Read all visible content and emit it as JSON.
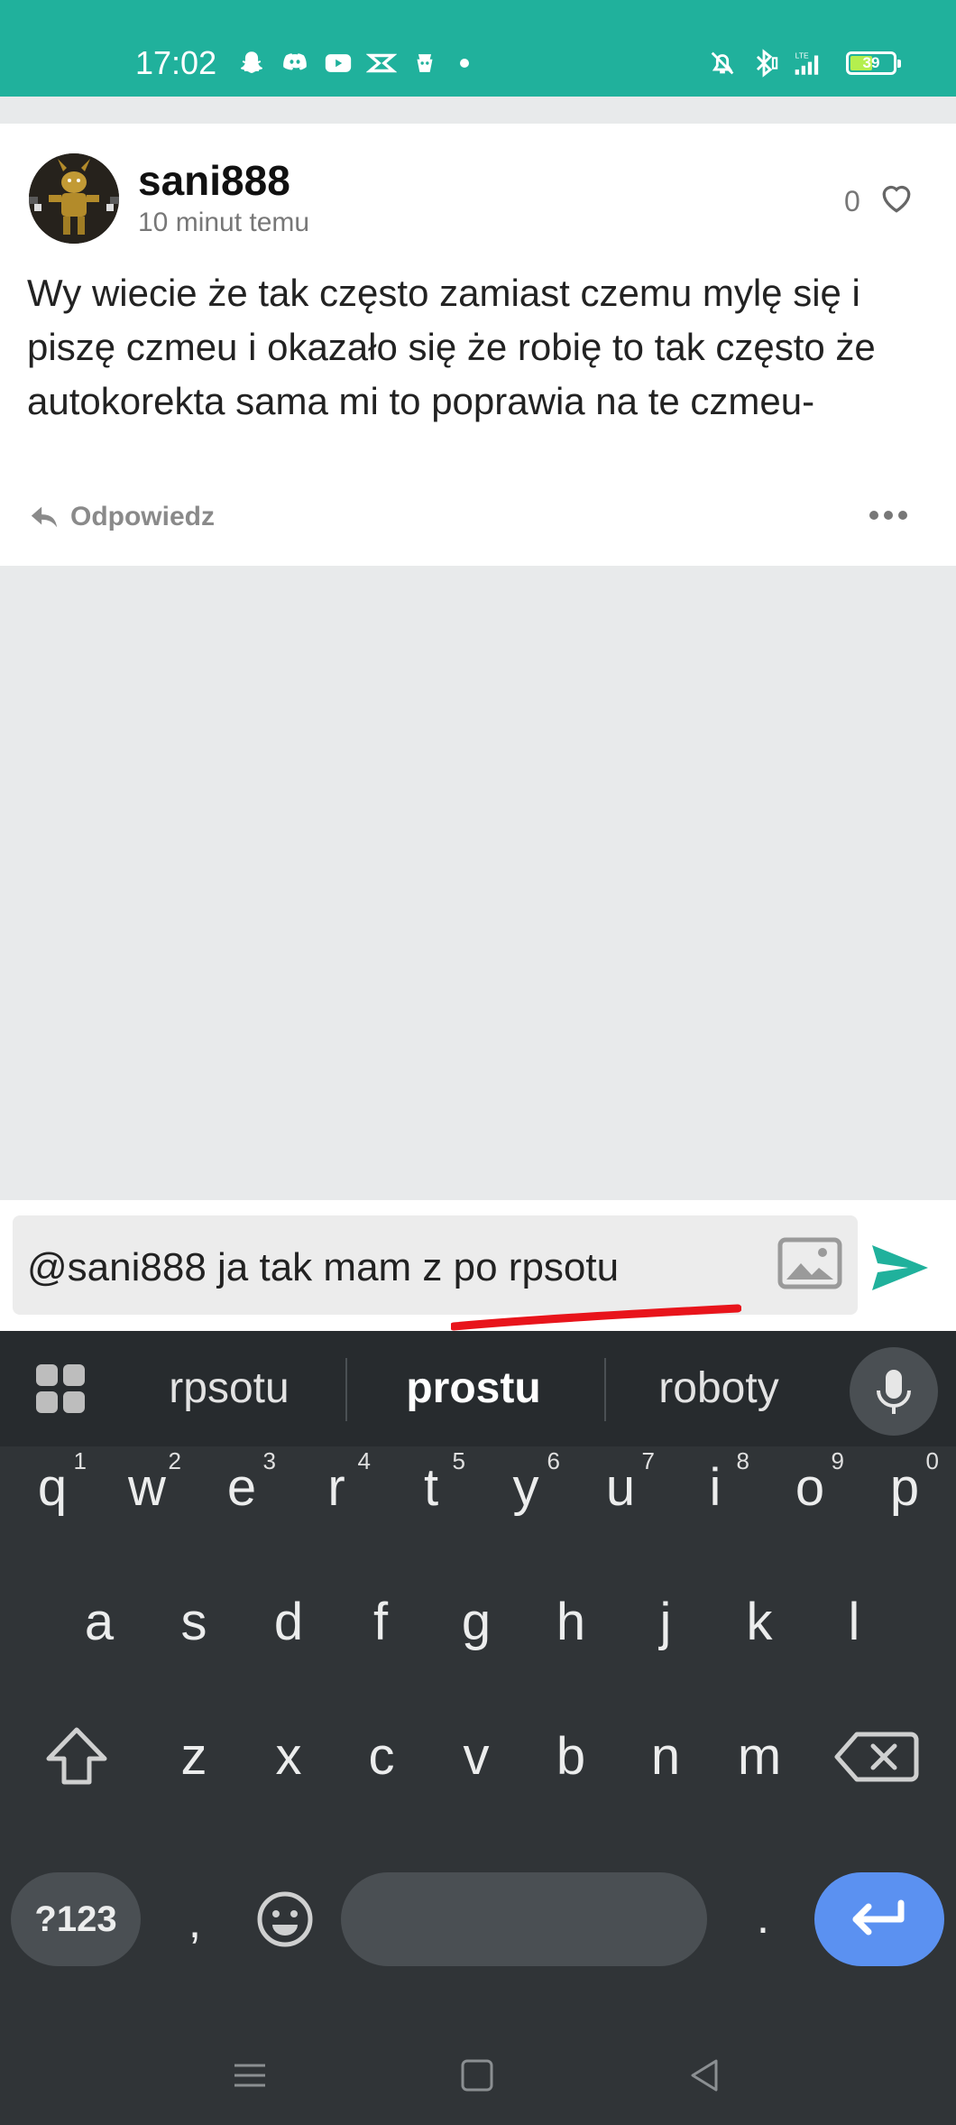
{
  "status_bar": {
    "time": "17:02",
    "battery_level": "39",
    "left_icons": [
      "snapchat-icon",
      "discord-icon",
      "youtube-icon",
      "capcut-icon",
      "app-icon",
      "more-dot"
    ],
    "right_icons": [
      "bell-off-icon",
      "bluetooth-icon",
      "lte-signal-icon",
      "battery-icon"
    ],
    "bg_color": "#20b19c"
  },
  "post": {
    "username": "sani888",
    "time_ago": "10 minut temu",
    "like_count": "0",
    "text": "Wy wiecie że tak często zamiast czemu mylę się i piszę czmeu i okazało się że robię to tak często że autokorekta sama mi to poprawia na te czmeu-",
    "reply_label": "Odpowiedz"
  },
  "composer": {
    "value": "@sani888 ja tak mam z po rpsotu",
    "send_color": "#20b19c"
  },
  "keyboard": {
    "suggestions": [
      "rpsotu",
      "prostu",
      "roboty"
    ],
    "row1": [
      {
        "k": "q",
        "h": "1"
      },
      {
        "k": "w",
        "h": "2"
      },
      {
        "k": "e",
        "h": "3"
      },
      {
        "k": "r",
        "h": "4"
      },
      {
        "k": "t",
        "h": "5"
      },
      {
        "k": "y",
        "h": "6"
      },
      {
        "k": "u",
        "h": "7"
      },
      {
        "k": "i",
        "h": "8"
      },
      {
        "k": "o",
        "h": "9"
      },
      {
        "k": "p",
        "h": "0"
      }
    ],
    "row2": [
      "a",
      "s",
      "d",
      "f",
      "g",
      "h",
      "j",
      "k",
      "l"
    ],
    "row3": [
      "z",
      "x",
      "c",
      "v",
      "b",
      "n",
      "m"
    ],
    "numbers_label": "?123",
    "comma": ",",
    "period": ".",
    "accent_color": "#5b91f1"
  }
}
